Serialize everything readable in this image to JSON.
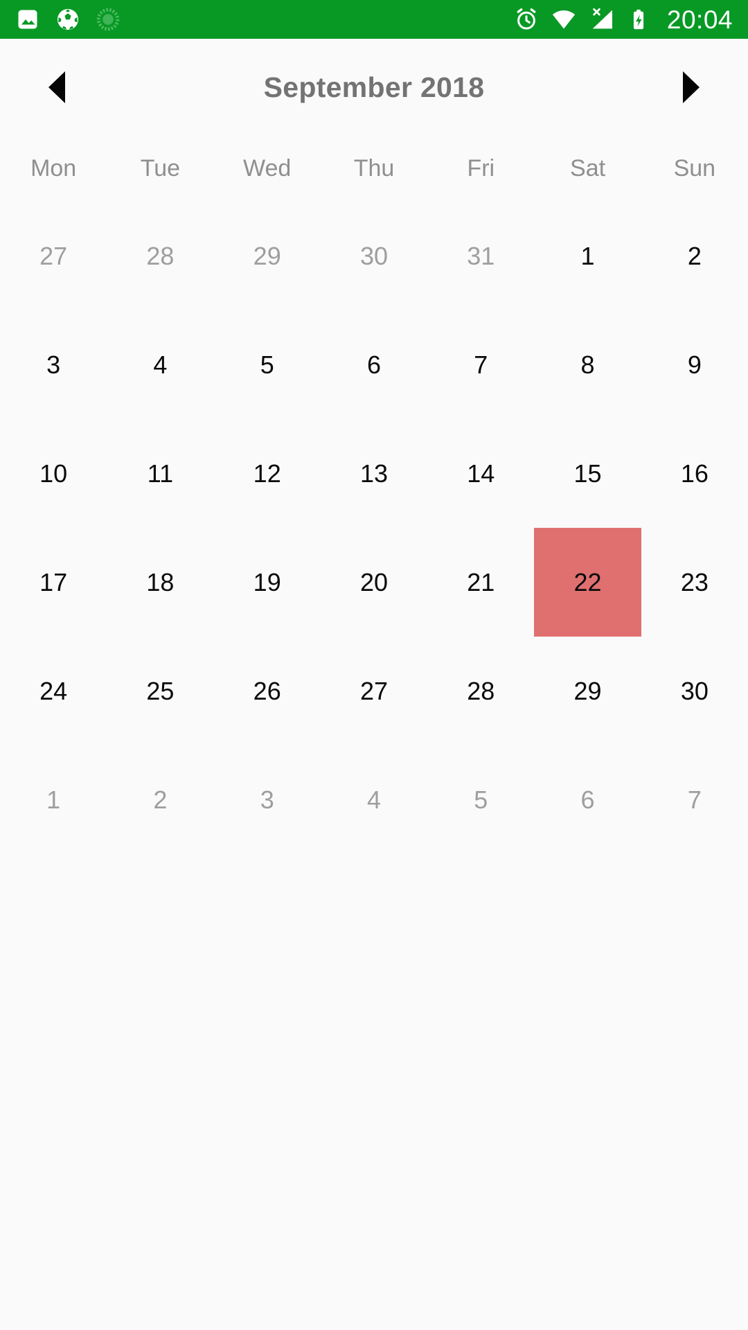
{
  "status_bar": {
    "background_color": "#089925",
    "left_icons": [
      {
        "name": "photo-icon",
        "label": "photo"
      },
      {
        "name": "soccer-ball-icon",
        "label": "soccer ball"
      },
      {
        "name": "sync-progress-icon",
        "label": "sync"
      }
    ],
    "right_icons": [
      {
        "name": "alarm-clock-icon",
        "label": "alarm"
      },
      {
        "name": "wifi-icon",
        "label": "wifi"
      },
      {
        "name": "cell-signal-no-sim-icon",
        "label": "no sim"
      },
      {
        "name": "battery-charging-icon",
        "label": "battery charging"
      }
    ],
    "clock": "20:04"
  },
  "header": {
    "prev_label": "◀",
    "next_label": "▶",
    "title": "September 2018"
  },
  "calendar": {
    "selected_day": "22",
    "selected_color": "#e07070",
    "weekdays": [
      "Mon",
      "Tue",
      "Wed",
      "Thu",
      "Fri",
      "Sat",
      "Sun"
    ],
    "weeks": [
      [
        {
          "day": "27",
          "outside": true,
          "selected": false
        },
        {
          "day": "28",
          "outside": true,
          "selected": false
        },
        {
          "day": "29",
          "outside": true,
          "selected": false
        },
        {
          "day": "30",
          "outside": true,
          "selected": false
        },
        {
          "day": "31",
          "outside": true,
          "selected": false
        },
        {
          "day": "1",
          "outside": false,
          "selected": false
        },
        {
          "day": "2",
          "outside": false,
          "selected": false
        }
      ],
      [
        {
          "day": "3",
          "outside": false,
          "selected": false
        },
        {
          "day": "4",
          "outside": false,
          "selected": false
        },
        {
          "day": "5",
          "outside": false,
          "selected": false
        },
        {
          "day": "6",
          "outside": false,
          "selected": false
        },
        {
          "day": "7",
          "outside": false,
          "selected": false
        },
        {
          "day": "8",
          "outside": false,
          "selected": false
        },
        {
          "day": "9",
          "outside": false,
          "selected": false
        }
      ],
      [
        {
          "day": "10",
          "outside": false,
          "selected": false
        },
        {
          "day": "11",
          "outside": false,
          "selected": false
        },
        {
          "day": "12",
          "outside": false,
          "selected": false
        },
        {
          "day": "13",
          "outside": false,
          "selected": false
        },
        {
          "day": "14",
          "outside": false,
          "selected": false
        },
        {
          "day": "15",
          "outside": false,
          "selected": false
        },
        {
          "day": "16",
          "outside": false,
          "selected": false
        }
      ],
      [
        {
          "day": "17",
          "outside": false,
          "selected": false
        },
        {
          "day": "18",
          "outside": false,
          "selected": false
        },
        {
          "day": "19",
          "outside": false,
          "selected": false
        },
        {
          "day": "20",
          "outside": false,
          "selected": false
        },
        {
          "day": "21",
          "outside": false,
          "selected": false
        },
        {
          "day": "22",
          "outside": false,
          "selected": true
        },
        {
          "day": "23",
          "outside": false,
          "selected": false
        }
      ],
      [
        {
          "day": "24",
          "outside": false,
          "selected": false
        },
        {
          "day": "25",
          "outside": false,
          "selected": false
        },
        {
          "day": "26",
          "outside": false,
          "selected": false
        },
        {
          "day": "27",
          "outside": false,
          "selected": false
        },
        {
          "day": "28",
          "outside": false,
          "selected": false
        },
        {
          "day": "29",
          "outside": false,
          "selected": false
        },
        {
          "day": "30",
          "outside": false,
          "selected": false
        }
      ],
      [
        {
          "day": "1",
          "outside": true,
          "selected": false
        },
        {
          "day": "2",
          "outside": true,
          "selected": false
        },
        {
          "day": "3",
          "outside": true,
          "selected": false
        },
        {
          "day": "4",
          "outside": true,
          "selected": false
        },
        {
          "day": "5",
          "outside": true,
          "selected": false
        },
        {
          "day": "6",
          "outside": true,
          "selected": false
        },
        {
          "day": "7",
          "outside": true,
          "selected": false
        }
      ]
    ]
  }
}
